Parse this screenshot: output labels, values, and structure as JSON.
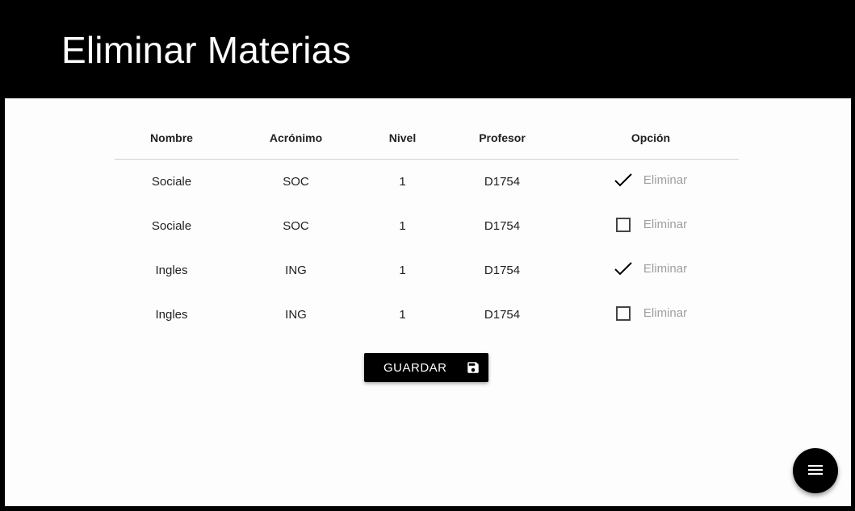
{
  "header": {
    "title": "Eliminar Materias"
  },
  "table": {
    "columns": [
      "Nombre",
      "Acrónimo",
      "Nivel",
      "Profesor",
      "Opción"
    ],
    "rows": [
      {
        "nombre": "Sociale",
        "acronimo": "SOC",
        "nivel": "1",
        "profesor": "D1754",
        "checked": true,
        "option_label": "Eliminar"
      },
      {
        "nombre": "Sociale",
        "acronimo": "SOC",
        "nivel": "1",
        "profesor": "D1754",
        "checked": false,
        "option_label": "Eliminar"
      },
      {
        "nombre": "Ingles",
        "acronimo": "ING",
        "nivel": "1",
        "profesor": "D1754",
        "checked": true,
        "option_label": "Eliminar"
      },
      {
        "nombre": "Ingles",
        "acronimo": "ING",
        "nivel": "1",
        "profesor": "D1754",
        "checked": false,
        "option_label": "Eliminar"
      }
    ]
  },
  "actions": {
    "save_label": "GUARDAR",
    "save_icon": "floppy-disk-icon",
    "fab_icon": "menu-icon"
  },
  "colors": {
    "header_background": "#000000",
    "content_background": "#fdfdfd",
    "button_background": "#000000",
    "option_label": "#9e9e9e"
  }
}
